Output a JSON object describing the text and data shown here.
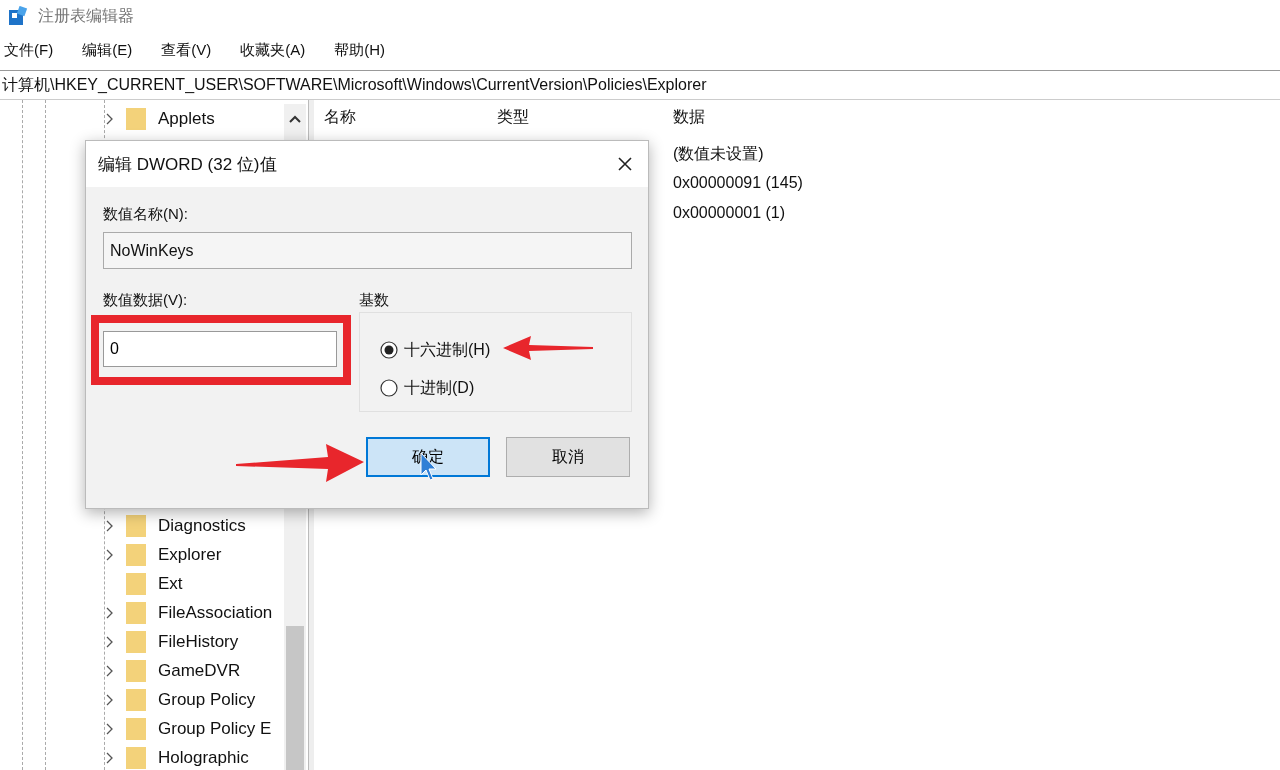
{
  "window": {
    "title": "注册表编辑器"
  },
  "menu": [
    "文件(F)",
    "编辑(E)",
    "查看(V)",
    "收藏夹(A)",
    "帮助(H)"
  ],
  "address": "计算机\\HKEY_CURRENT_USER\\SOFTWARE\\Microsoft\\Windows\\CurrentVersion\\Policies\\Explorer",
  "tree": {
    "items_above_dialog": [
      {
        "label": "Applets",
        "has_children": true
      }
    ],
    "items_below_dialog": [
      {
        "label": "Diagnostics",
        "has_children": true
      },
      {
        "label": "Explorer",
        "has_children": true
      },
      {
        "label": "Ext",
        "has_children": false
      },
      {
        "label": "FileAssociation",
        "has_children": true
      },
      {
        "label": "FileHistory",
        "has_children": true
      },
      {
        "label": "GameDVR",
        "has_children": true
      },
      {
        "label": "Group Policy",
        "has_children": true
      },
      {
        "label": "Group Policy E",
        "has_children": true
      },
      {
        "label": "Holographic",
        "has_children": true
      }
    ]
  },
  "values": {
    "columns": [
      "名称",
      "类型",
      "数据"
    ],
    "rows": [
      {
        "data": "(数值未设置)"
      },
      {
        "data": "0x00000091 (145)"
      },
      {
        "data": "0x00000001 (1)"
      }
    ]
  },
  "dialog": {
    "title": "编辑 DWORD (32 位)值",
    "name_label": "数值名称(N):",
    "name_value": "NoWinKeys",
    "data_label": "数值数据(V):",
    "data_value": "0",
    "base_label": "基数",
    "bases": [
      {
        "label": "十六进制(H)",
        "selected": true
      },
      {
        "label": "十进制(D)",
        "selected": false
      }
    ],
    "buttons": [
      {
        "label": "确定",
        "default": true
      },
      {
        "label": "取消",
        "default": false
      }
    ]
  }
}
